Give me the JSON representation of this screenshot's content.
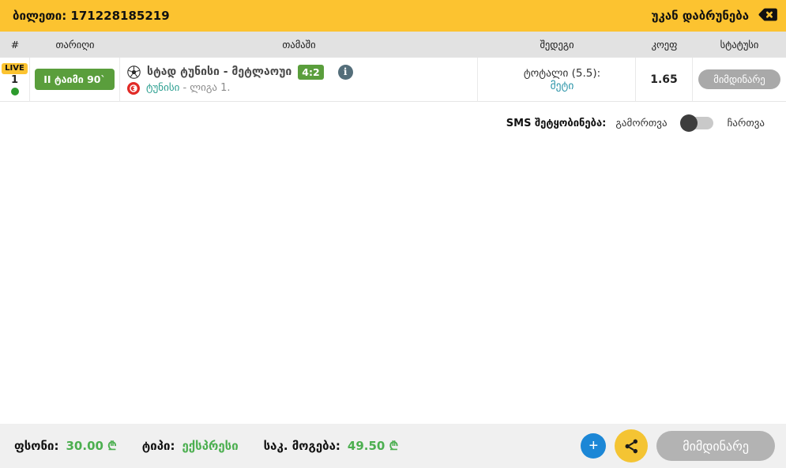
{
  "topbar": {
    "ticket_label": "ბილეთი: 171228185219",
    "back_label": "უკან დაბრუნება"
  },
  "table": {
    "columns": {
      "num": "#",
      "date": "თარიღი",
      "game": "თამაში",
      "result": "შედეგი",
      "coef": "კოეფ",
      "status": "სტატუსი"
    },
    "row": {
      "live_badge": "LIVE",
      "number": "1",
      "time_badge": "II ტაიმი 90`",
      "match_title": "სტად ტუნისი - მეტლაოუი",
      "score": "4:2",
      "league_team": "ტუნისი",
      "league_rest": "- ლიგა 1.",
      "pick_label": "ტოტალი (5.5): ",
      "pick_value": "მეტი",
      "coef": "1.65",
      "status": "მიმდინარე"
    }
  },
  "sms": {
    "label": "SMS შეტყობინება:",
    "off_label": "გამორთვა",
    "on_label": "ჩართვა",
    "state": "off"
  },
  "footer": {
    "stake_label": "ფსონი:",
    "stake_value": "30.00 ₾",
    "type_label": "ტიპი:",
    "type_value": "ექსპრესი",
    "win_label": "საკ. მოგება:",
    "win_value": "49.50 ₾",
    "submit_label": "მიმდინარე"
  },
  "icons": {
    "info": "i",
    "plus": "+"
  },
  "colors": {
    "brand_yellow": "#fcc330",
    "live_green": "#5a9e3c",
    "dot_green": "#2d9b2d",
    "money_green": "#4caf50",
    "link_teal": "#2a9e8f",
    "pick_teal": "#2b94a8",
    "info_slate": "#546e7a",
    "status_gray": "#a9a9a9",
    "plus_blue": "#1c87d6",
    "share_yellow": "#f4c433"
  }
}
